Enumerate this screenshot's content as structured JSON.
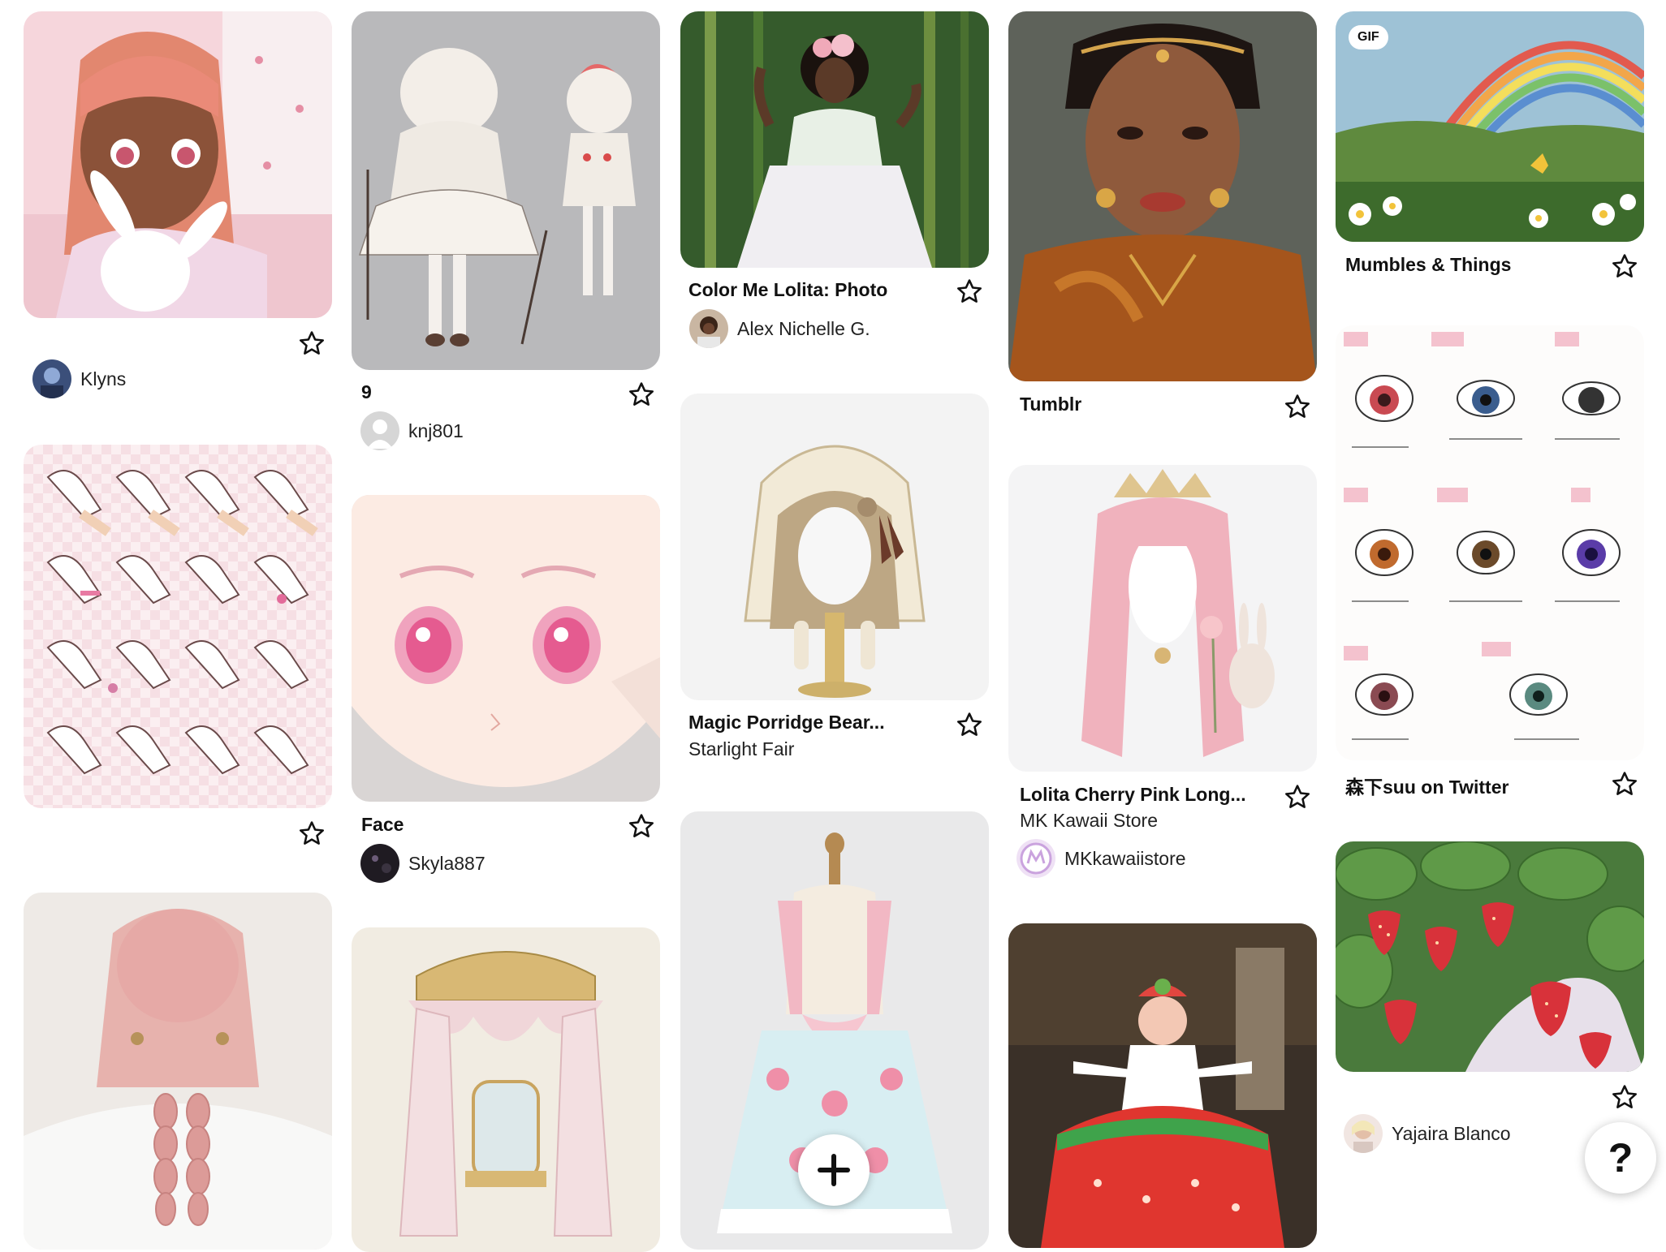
{
  "colors": {
    "page_background": "#ffffff",
    "text": "#111111",
    "accent_pink": "#f4a6b8"
  },
  "icons": {
    "save": "star-icon",
    "create": "plus-icon",
    "help": "question-icon"
  },
  "pins": [
    {
      "title": "",
      "subtitle": "",
      "user": "Klyns",
      "alt": "anime girl with pink hair holding white bunny"
    },
    {
      "title": "",
      "subtitle": "",
      "user": "",
      "alt": "pink checkered sleeve cuff design sheet"
    },
    {
      "title": "",
      "subtitle": "",
      "user": "",
      "alt": "pink braided hairstyle from behind"
    },
    {
      "title": "9",
      "subtitle": "",
      "user": "knj801",
      "alt": "white lolita character design on grey background"
    },
    {
      "title": "Face",
      "subtitle": "",
      "user": "Skyla887",
      "alt": "anime face with pink eyes"
    },
    {
      "title": "",
      "subtitle": "",
      "user": "",
      "alt": "ornate pink canopy bed drawing"
    },
    {
      "title": "Color Me Lolita: Photo",
      "subtitle": "",
      "user": "Alex Nichelle G.",
      "alt": "woman in white lolita dress in bamboo forest"
    },
    {
      "title": "Magic Porridge Bear...",
      "subtitle": "Starlight Fair",
      "user": "",
      "alt": "knitted bear bonnet on wig stand"
    },
    {
      "title": "",
      "subtitle": "",
      "user": "",
      "alt": "pink strawberry lolita jumper skirt on mannequin"
    },
    {
      "title": "Tumblr",
      "subtitle": "",
      "user": "",
      "alt": "portrait of woman with gold jewelry"
    },
    {
      "title": "Lolita Cherry Pink Long...",
      "subtitle": "MK Kawaii Store",
      "user": "MKkawaiistore",
      "alt": "pink curly lolita wig with crown"
    },
    {
      "title": "",
      "subtitle": "",
      "user": "",
      "alt": "performer in strawberry cake dress"
    },
    {
      "title": "Mumbles & Things",
      "subtitle": "",
      "user": "",
      "alt": "rainbow meadow painting",
      "badge": "GIF"
    },
    {
      "title": "森下suu on Twitter",
      "subtitle": "",
      "user": "",
      "alt": "anime eye drawing reference sheet"
    },
    {
      "title": "",
      "subtitle": "",
      "user": "Yajaira Blanco",
      "alt": "hand holding strawberries anime"
    }
  ],
  "fab": {
    "help_label": "?"
  }
}
